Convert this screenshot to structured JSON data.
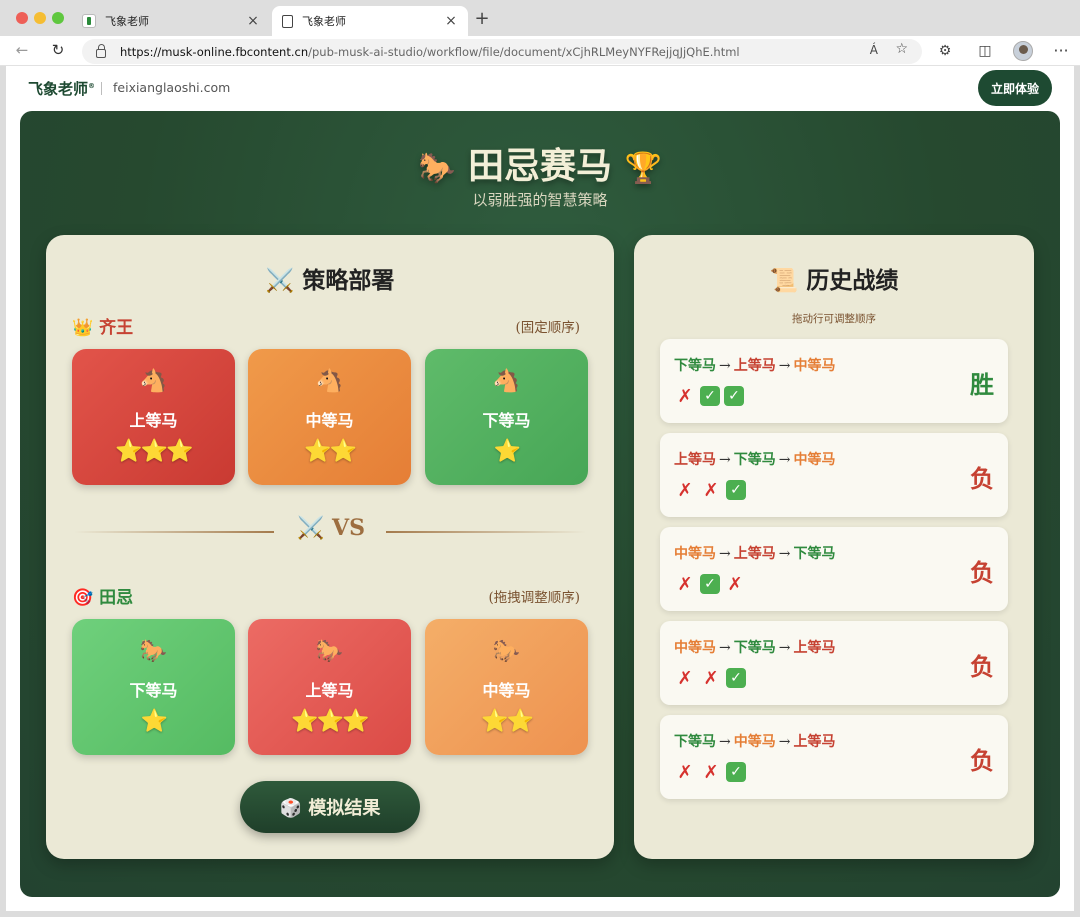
{
  "browser": {
    "tabs": [
      {
        "title": "飞象老师"
      },
      {
        "title": "飞象老师"
      }
    ],
    "new_tab": "+",
    "close": "×",
    "url_host": "https://musk-online.fbcontent.cn",
    "url_path": "/pub-musk-ai-studio/workflow/file/document/xCjhRLMeyNYFRejjqJjQhE.html",
    "back": "←",
    "reload": "↻",
    "read_aloud": "Á",
    "favorite": "☆",
    "extensions": "⚙",
    "split": "◫",
    "more": "···"
  },
  "site": {
    "brand": "飞象老师",
    "brand_mark": "®",
    "domain": "feixianglaoshi.com",
    "cta": "立即体验"
  },
  "hero": {
    "icon_left": "🐎",
    "title": "田忌赛马",
    "icon_right": "🏆",
    "subtitle": "以弱胜强的智慧策略"
  },
  "strategy": {
    "icon": "⚔️",
    "title": "策略部署",
    "qi": {
      "icon": "👑",
      "name": "齐王",
      "note": "(固定顺序)"
    },
    "tian": {
      "icon": "🎯",
      "name": "田忌",
      "note": "(拖拽调整顺序)"
    },
    "qi_horses": [
      {
        "icon": "🐴",
        "label": "上等马",
        "stars": "⭐⭐⭐"
      },
      {
        "icon": "🐴",
        "label": "中等马",
        "stars": "⭐⭐"
      },
      {
        "icon": "🐴",
        "label": "下等马",
        "stars": "⭐"
      }
    ],
    "tian_horses": [
      {
        "icon": "🐎",
        "label": "下等马",
        "stars": "⭐"
      },
      {
        "icon": "🐎",
        "label": "上等马",
        "stars": "⭐⭐⭐"
      },
      {
        "icon": "🐎",
        "label": "中等马",
        "stars": "⭐⭐"
      }
    ],
    "vs_icon": "⚔️",
    "vs": "VS",
    "simulate_icon": "🎲",
    "simulate": "模拟结果"
  },
  "history": {
    "icon": "📜",
    "title": "历史战绩",
    "hint": "拖动行可调整顺序",
    "arrow": "→",
    "records": [
      {
        "seq": [
          "下等马",
          "上等马",
          "中等马"
        ],
        "marks": [
          "✗",
          "✓",
          "✓"
        ],
        "result": "胜"
      },
      {
        "seq": [
          "上等马",
          "下等马",
          "中等马"
        ],
        "marks": [
          "✗",
          "✗",
          "✓"
        ],
        "result": "负"
      },
      {
        "seq": [
          "中等马",
          "上等马",
          "下等马"
        ],
        "marks": [
          "✗",
          "✓",
          "✗"
        ],
        "result": "负"
      },
      {
        "seq": [
          "中等马",
          "下等马",
          "上等马"
        ],
        "marks": [
          "✗",
          "✗",
          "✓"
        ],
        "result": "负"
      },
      {
        "seq": [
          "下等马",
          "中等马",
          "上等马"
        ],
        "marks": [
          "✗",
          "✗",
          "✓"
        ],
        "result": "负"
      }
    ]
  }
}
